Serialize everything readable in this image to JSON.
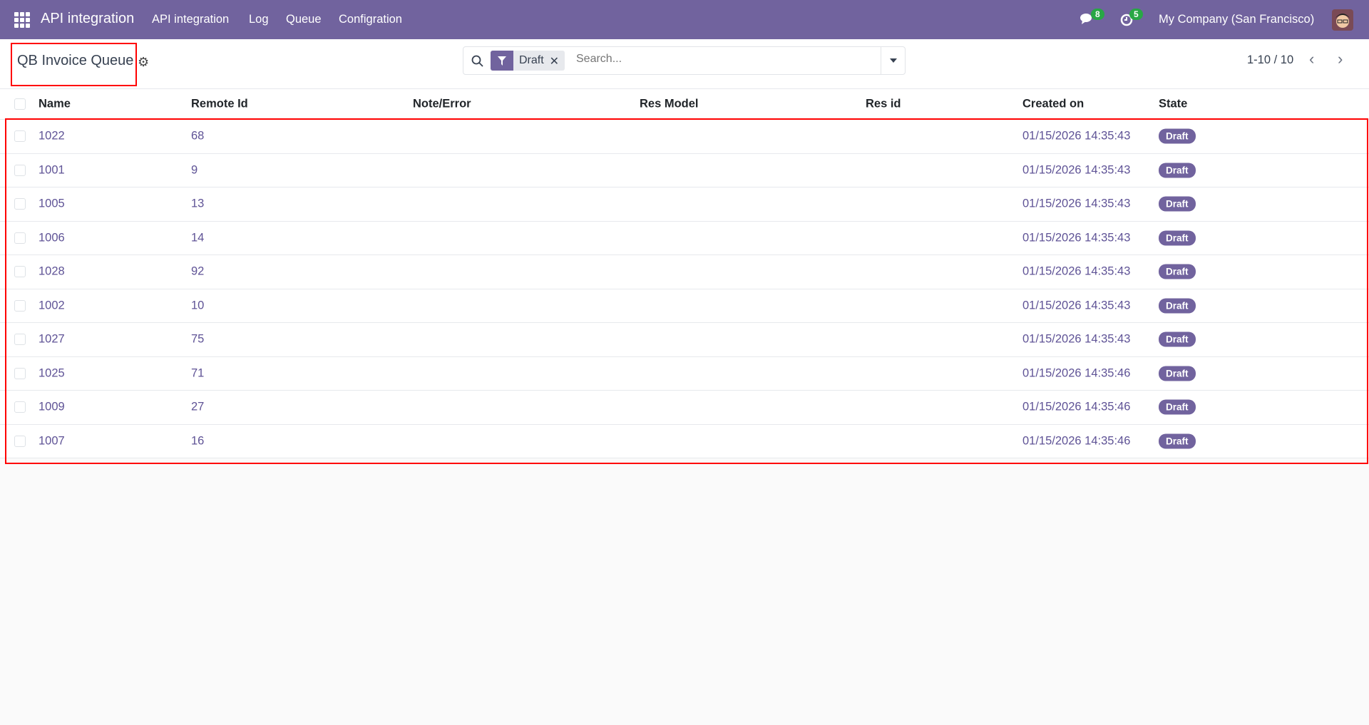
{
  "navbar": {
    "app_name": "API integration",
    "menu": [
      "API integration",
      "Log",
      "Queue",
      "Configration"
    ],
    "messages_count": "8",
    "activities_count": "5",
    "company": "My Company (San Francisco)"
  },
  "control": {
    "title": "QB Invoice Queue",
    "facet": "Draft",
    "search_placeholder": "Search...",
    "pager": "1-10 / 10"
  },
  "table": {
    "columns": [
      "Name",
      "Remote Id",
      "Note/Error",
      "Res Model",
      "Res id",
      "Created on",
      "State"
    ],
    "rows": [
      {
        "name": "1022",
        "remote_id": "68",
        "created_on": "01/15/2026 14:35:43",
        "state": "Draft"
      },
      {
        "name": "1001",
        "remote_id": "9",
        "created_on": "01/15/2026 14:35:43",
        "state": "Draft"
      },
      {
        "name": "1005",
        "remote_id": "13",
        "created_on": "01/15/2026 14:35:43",
        "state": "Draft"
      },
      {
        "name": "1006",
        "remote_id": "14",
        "created_on": "01/15/2026 14:35:43",
        "state": "Draft"
      },
      {
        "name": "1028",
        "remote_id": "92",
        "created_on": "01/15/2026 14:35:43",
        "state": "Draft"
      },
      {
        "name": "1002",
        "remote_id": "10",
        "created_on": "01/15/2026 14:35:43",
        "state": "Draft"
      },
      {
        "name": "1027",
        "remote_id": "75",
        "created_on": "01/15/2026 14:35:43",
        "state": "Draft"
      },
      {
        "name": "1025",
        "remote_id": "71",
        "created_on": "01/15/2026 14:35:46",
        "state": "Draft"
      },
      {
        "name": "1009",
        "remote_id": "27",
        "created_on": "01/15/2026 14:35:46",
        "state": "Draft"
      },
      {
        "name": "1007",
        "remote_id": "16",
        "created_on": "01/15/2026 14:35:46",
        "state": "Draft"
      }
    ]
  },
  "colors": {
    "brand": "#71639e",
    "badge": "#28a745",
    "highlight": "#ff0000"
  }
}
